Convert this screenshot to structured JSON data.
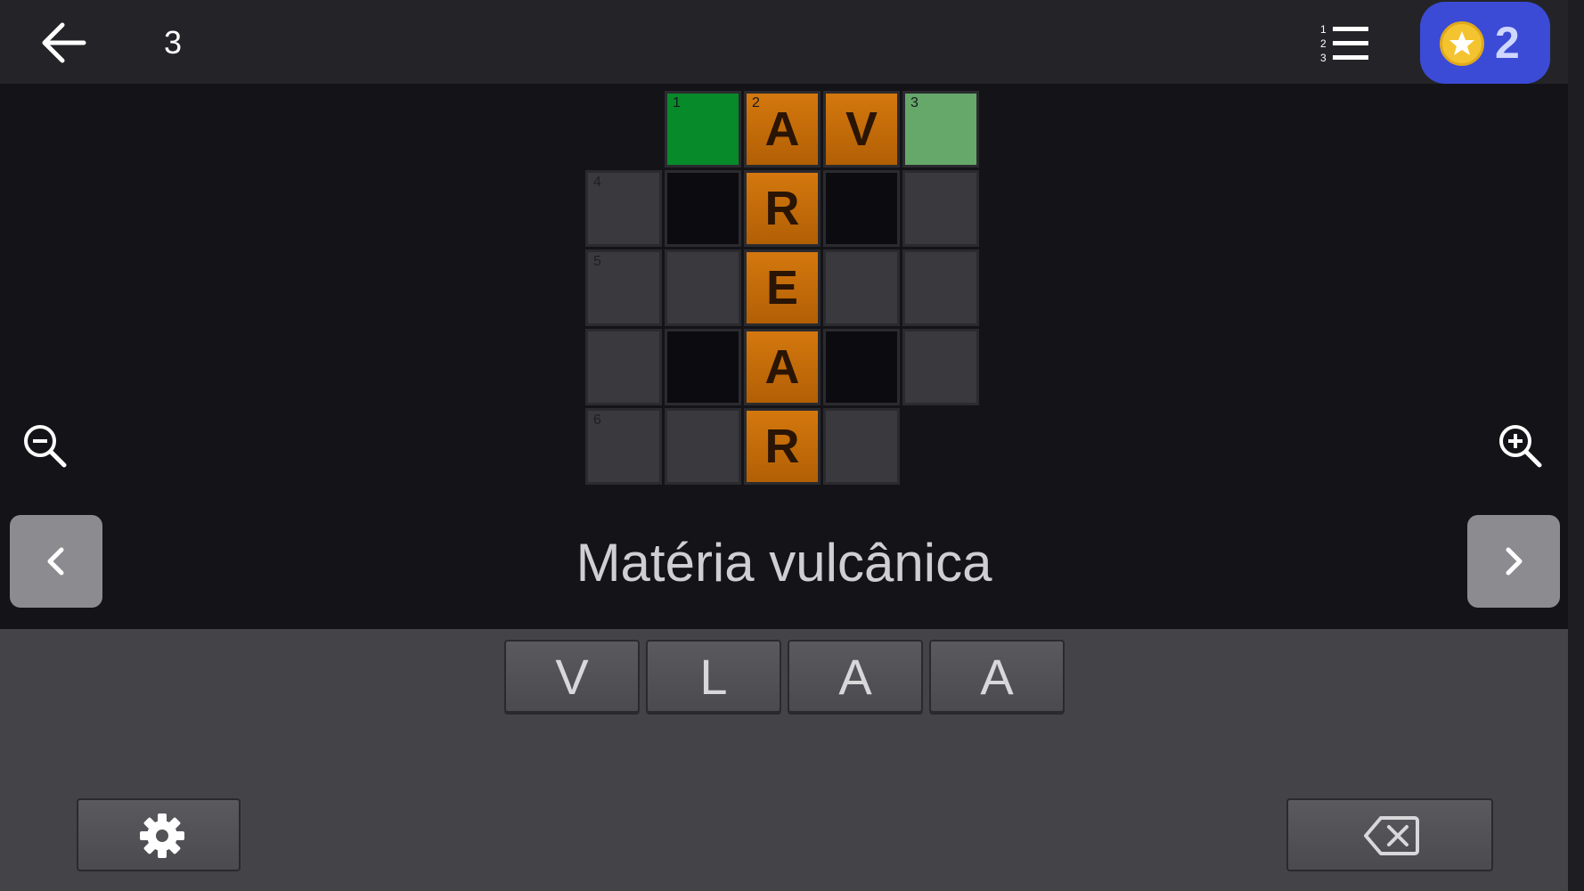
{
  "header": {
    "level": "3",
    "coins": "2",
    "back_icon": "arrow-left-icon",
    "list_icon": "numbered-list-icon",
    "coin_icon": "star-coin-icon"
  },
  "grid": {
    "cells": [
      {
        "num": "1",
        "letter": ""
      },
      {
        "num": "2",
        "letter": "A"
      },
      {
        "num": "",
        "letter": "V"
      },
      {
        "num": "3",
        "letter": ""
      },
      {
        "num": "4",
        "letter": ""
      },
      {
        "num": "",
        "letter": "R"
      },
      {
        "num": "5",
        "letter": ""
      },
      {
        "num": "",
        "letter": ""
      },
      {
        "num": "",
        "letter": "E"
      },
      {
        "num": "",
        "letter": ""
      },
      {
        "num": "",
        "letter": ""
      },
      {
        "num": "",
        "letter": ""
      },
      {
        "num": "",
        "letter": "A"
      },
      {
        "num": "",
        "letter": ""
      },
      {
        "num": "6",
        "letter": ""
      },
      {
        "num": "",
        "letter": ""
      },
      {
        "num": "",
        "letter": "R"
      },
      {
        "num": "",
        "letter": ""
      },
      {
        "num": "",
        "letter": ""
      }
    ]
  },
  "clue": {
    "text": "Matéria vulcânica"
  },
  "keyboard": {
    "letters": [
      "V",
      "L",
      "A",
      "A"
    ],
    "settings_icon": "gear-icon",
    "delete_icon": "backspace-icon"
  },
  "colors": {
    "topbar": "#242428",
    "board_bg": "#141418",
    "selected_cell": "#078a2a",
    "completed_cell": "#66a86a",
    "active_word": "#c86d0a",
    "coin_badge": "#3b4bd6",
    "keyboard_bg": "#444448"
  }
}
